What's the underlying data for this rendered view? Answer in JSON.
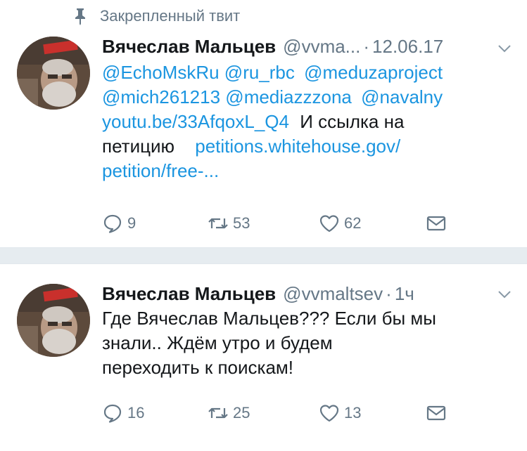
{
  "pinned_label": "Закрепленный твит",
  "tweets": [
    {
      "name": "Вячеслав Мальцев",
      "handle": "@vvma...",
      "dot": "·",
      "time": "12.06.17",
      "lines": [
        [
          "@EchoMskRu",
          "@ru_rbc",
          "@meduzaproject"
        ],
        [
          "@mich261213",
          "@mediazzzona",
          "@navalny"
        ],
        [
          "youtu.be/33AfqoxL_Q4",
          "И ссылка на"
        ],
        [
          "петицию",
          "petitions.whitehouse.gov/"
        ],
        [
          "petition/free-..."
        ]
      ],
      "replies": "9",
      "retweets": "53",
      "likes": "62"
    },
    {
      "name": "Вячеслав Мальцев",
      "handle": "@vvmaltsev",
      "dot": "·",
      "time": "1ч",
      "lines": [
        "Где Вячеслав Мальцев??? Если бы мы",
        "знали.. Ждём утро и будем",
        "переходить к поискам!"
      ],
      "replies": "16",
      "retweets": "25",
      "likes": "13"
    }
  ],
  "icons": {
    "pin": "pin-icon",
    "chevron": "chevron-down-icon",
    "reply": "reply-icon",
    "retweet": "retweet-icon",
    "like": "heart-icon",
    "dm": "envelope-icon"
  },
  "colors": {
    "link": "#1b95e0",
    "muted": "#657786",
    "text": "#14171a",
    "separator": "#e6ecf0"
  }
}
